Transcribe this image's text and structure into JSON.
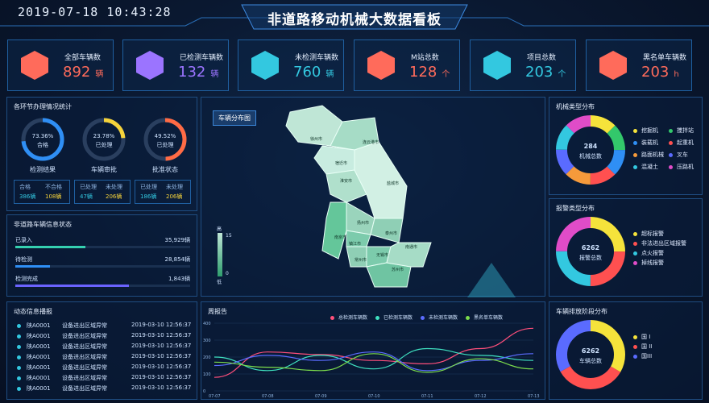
{
  "header": {
    "datetime": "2019-07-18 10:43:28",
    "title": "非道路移动机械大数据看板"
  },
  "kpis": [
    {
      "label": "全部车辆数",
      "value": "892",
      "unit": "辆",
      "color": "#ff6b5b",
      "icon": "car-icon"
    },
    {
      "label": "已检测车辆数",
      "value": "132",
      "unit": "辆",
      "color": "#9b74ff",
      "icon": "shield-check-icon"
    },
    {
      "label": "未检测车辆数",
      "value": "760",
      "unit": "辆",
      "color": "#33c8e0",
      "icon": "warning-icon"
    },
    {
      "label": "M站总数",
      "value": "128",
      "unit": "个",
      "color": "#ff6b5b",
      "icon": "building-icon"
    },
    {
      "label": "项目总数",
      "value": "203",
      "unit": "个",
      "color": "#33c8e0",
      "icon": "layers-icon"
    },
    {
      "label": "黑名单车辆数",
      "value": "203",
      "unit": "h",
      "color": "#ff6b5b",
      "icon": "no-car-icon"
    }
  ],
  "stats": {
    "title": "各环节办理情况统计",
    "rings": [
      {
        "pct": "73.36%",
        "sub": "合格",
        "name": "检测结果",
        "color": "#2f8ff5",
        "frac": 0.7336
      },
      {
        "pct": "23.78%",
        "sub": "已处理",
        "name": "车辆审批",
        "color": "#f5d33b",
        "frac": 0.2378
      },
      {
        "pct": "49.52%",
        "sub": "已处理",
        "name": "批准状态",
        "color": "#ff6b45",
        "frac": 0.4952
      }
    ],
    "boxes": [
      {
        "h1": "合格",
        "h2": "不合格",
        "v1": "386辆",
        "v2": "108辆"
      },
      {
        "h1": "已处理",
        "h2": "未处理",
        "v1": "47辆",
        "v2": "206辆"
      },
      {
        "h1": "已处理",
        "h2": "未处理",
        "v1": "186辆",
        "v2": "206辆"
      }
    ]
  },
  "vinfo": {
    "title": "非道路车辆信息状态",
    "rows": [
      {
        "label": "已录入",
        "value": "35,929辆",
        "frac": 0.4,
        "color": "#35d0b0"
      },
      {
        "label": "待检测",
        "value": "28,854辆",
        "frac": 0.2,
        "color": "#2f8ff5"
      },
      {
        "label": "检测完成",
        "value": "1,843辆",
        "frac": 0.65,
        "color": "#6b63ff"
      }
    ]
  },
  "feed": {
    "title": "动态信息播报",
    "rows": [
      {
        "plate": "陕A0001",
        "event": "设备进出区域异常",
        "time": "2019-03-10 12:56:37"
      },
      {
        "plate": "陕A0001",
        "event": "设备进出区域异常",
        "time": "2019-03-10 12:56:37"
      },
      {
        "plate": "陕A0001",
        "event": "设备进出区域异常",
        "time": "2019-03-10 12:56:37"
      },
      {
        "plate": "陕A0001",
        "event": "设备进出区域异常",
        "time": "2019-03-10 12:56:37"
      },
      {
        "plate": "陕A0001",
        "event": "设备进出区域异常",
        "time": "2019-03-10 12:56:37"
      },
      {
        "plate": "陕A0001",
        "event": "设备进出区域异常",
        "time": "2019-03-10 12:56:37"
      },
      {
        "plate": "陕A0001",
        "event": "设备进出区域异常",
        "time": "2019-03-10 12:56:37"
      }
    ]
  },
  "map": {
    "title": "车辆分布图",
    "legend_high": "高",
    "legend_low": "低",
    "legend_top": "15",
    "legend_bottom": "0",
    "cities": [
      "徐州市",
      "连云港市",
      "宿迁市",
      "淮安市",
      "盐城市",
      "扬州市",
      "泰州市",
      "南京市",
      "镇江市",
      "常州市",
      "无锡市",
      "苏州市",
      "南通市"
    ]
  },
  "weekly": {
    "title": "周报告"
  },
  "mech": {
    "title": "机械类型分布",
    "center_value": "284",
    "center_label": "机械总数",
    "items": [
      {
        "name": "挖掘机",
        "color": "#f5e33b"
      },
      {
        "name": "搅拌站",
        "color": "#33c86b"
      },
      {
        "name": "装载机",
        "color": "#2f8ff5"
      },
      {
        "name": "起重机",
        "color": "#ff5050"
      },
      {
        "name": "路面机械",
        "color": "#f59a3b"
      },
      {
        "name": "叉车",
        "color": "#5a6bff"
      },
      {
        "name": "混凝土",
        "color": "#33c8e0"
      },
      {
        "name": "压路机",
        "color": "#e04cc8"
      }
    ]
  },
  "alarm": {
    "title": "报警类型分布",
    "center_value": "6262",
    "center_label": "报警总数",
    "items": [
      {
        "name": "超标报警",
        "color": "#f5e33b"
      },
      {
        "name": "非法进出区域报警",
        "color": "#ff5050"
      },
      {
        "name": "点火报警",
        "color": "#33c8e0"
      },
      {
        "name": "掉线报警",
        "color": "#e04cc8"
      }
    ]
  },
  "emission": {
    "title": "车辆排放阶段分布",
    "center_value": "6262",
    "center_label": "车辆总数",
    "items": [
      {
        "name": "国 I",
        "color": "#f5e33b"
      },
      {
        "name": "国 II",
        "color": "#ff5050"
      },
      {
        "name": "国III",
        "color": "#5a6bff"
      }
    ]
  },
  "chart_data": {
    "type": "line",
    "title": "周报告",
    "x": [
      "07-07",
      "07-08",
      "07-09",
      "07-10",
      "07-11",
      "07-12",
      "07-13"
    ],
    "ylim": [
      0,
      400
    ],
    "yticks": [
      0,
      100,
      200,
      300,
      400
    ],
    "series": [
      {
        "name": "总检测车辆数",
        "color": "#ff4f7b",
        "values": [
          80,
          230,
          215,
          180,
          160,
          250,
          370
        ]
      },
      {
        "name": "已检测车辆数",
        "color": "#3fe0c0",
        "values": [
          200,
          120,
          210,
          130,
          250,
          210,
          180
        ]
      },
      {
        "name": "未检测车辆数",
        "color": "#5b6cff",
        "values": [
          150,
          210,
          180,
          230,
          120,
          180,
          220
        ]
      },
      {
        "name": "黑名单车辆数",
        "color": "#7bdc4c",
        "values": [
          170,
          140,
          120,
          220,
          110,
          190,
          130
        ]
      }
    ]
  }
}
